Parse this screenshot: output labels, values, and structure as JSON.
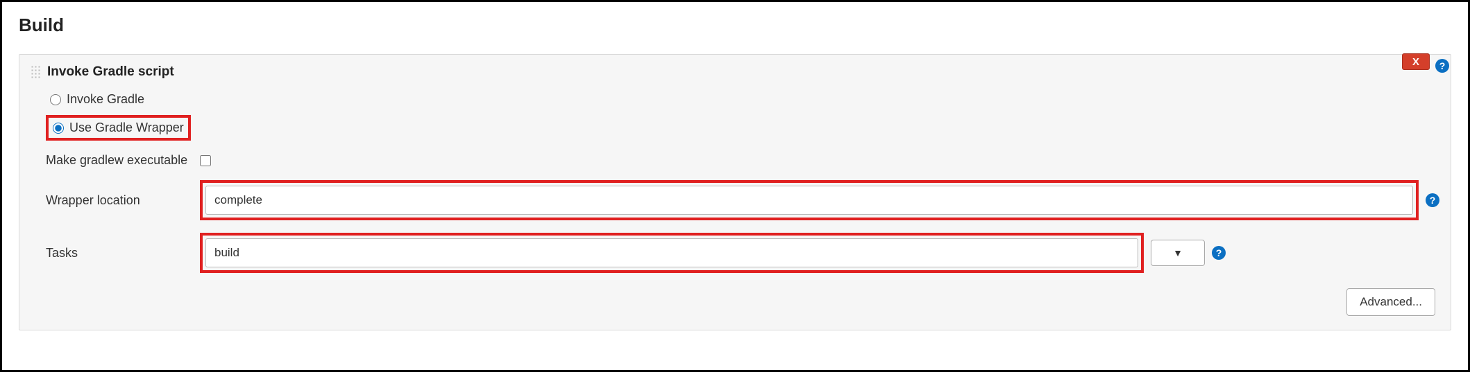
{
  "section": {
    "heading": "Build"
  },
  "panel": {
    "title": "Invoke Gradle script",
    "delete_label": "X",
    "radios": {
      "invoke_gradle": "Invoke Gradle",
      "use_wrapper": "Use Gradle Wrapper"
    },
    "fields": {
      "make_executable_label": "Make gradlew executable",
      "wrapper_location_label": "Wrapper location",
      "wrapper_location_value": "complete",
      "tasks_label": "Tasks",
      "tasks_value": "build"
    },
    "buttons": {
      "expand": "▼",
      "advanced": "Advanced..."
    },
    "help_glyph": "?"
  }
}
